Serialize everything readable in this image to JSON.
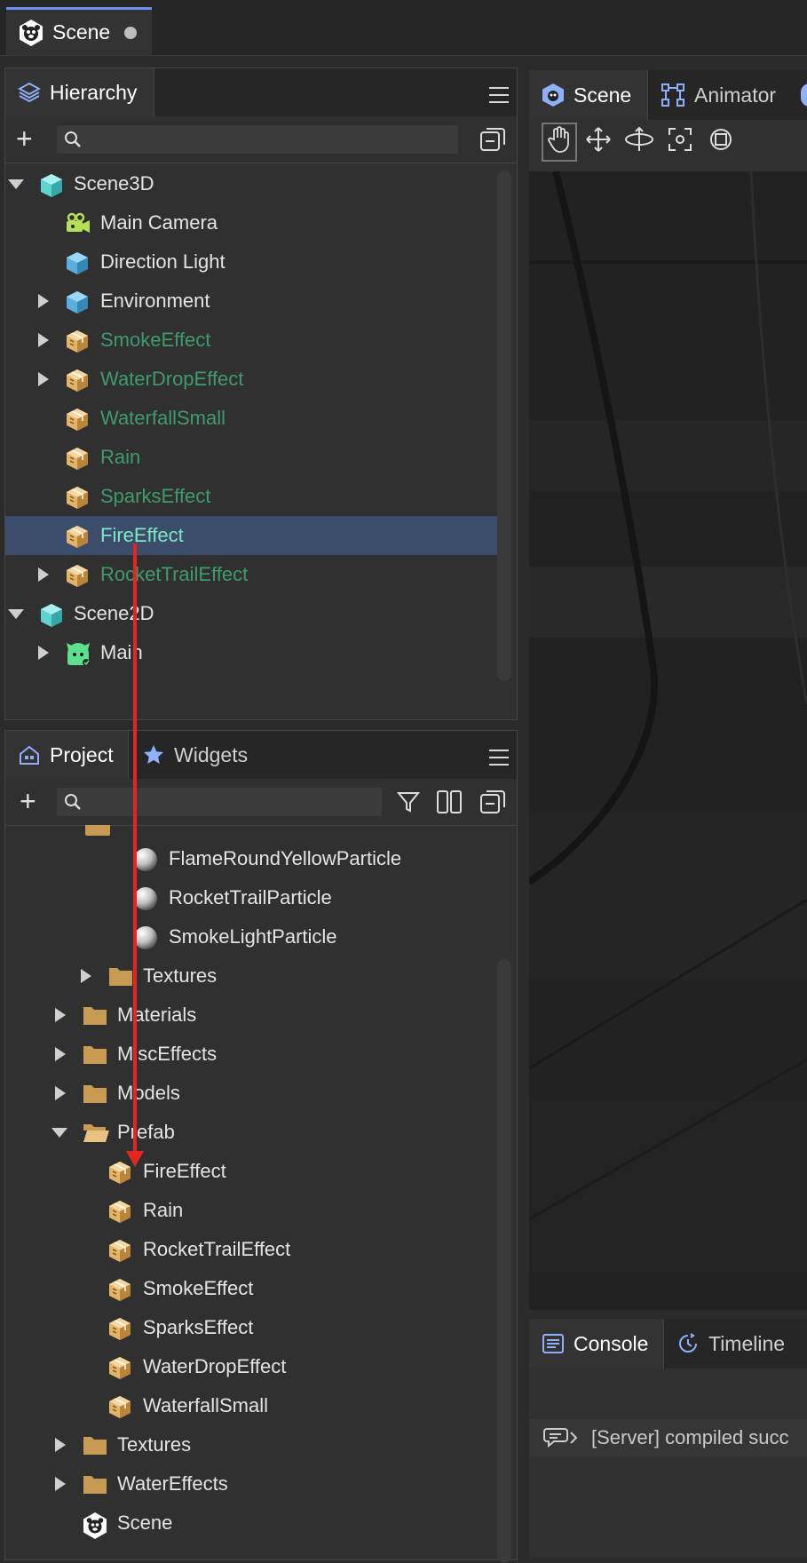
{
  "document_tab": {
    "label": "Scene"
  },
  "hierarchy": {
    "tab_label": "Hierarchy",
    "search_placeholder": "",
    "items": [
      {
        "label": "Scene3D",
        "kind": "scene3d",
        "level": 0,
        "arrow": "down",
        "prefab": false,
        "selected": false
      },
      {
        "label": "Main Camera",
        "kind": "camera",
        "level": 1,
        "arrow": "",
        "prefab": false,
        "selected": false
      },
      {
        "label": "Direction Light",
        "kind": "cube-blue",
        "level": 1,
        "arrow": "",
        "prefab": false,
        "selected": false
      },
      {
        "label": "Environment",
        "kind": "cube-blue",
        "level": 1,
        "arrow": "right",
        "prefab": false,
        "selected": false
      },
      {
        "label": "SmokeEffect",
        "kind": "prefab",
        "level": 1,
        "arrow": "right",
        "prefab": true,
        "selected": false
      },
      {
        "label": "WaterDropEffect",
        "kind": "prefab",
        "level": 1,
        "arrow": "right",
        "prefab": true,
        "selected": false
      },
      {
        "label": "WaterfallSmall",
        "kind": "prefab",
        "level": 1,
        "arrow": "",
        "prefab": true,
        "selected": false
      },
      {
        "label": "Rain",
        "kind": "prefab",
        "level": 1,
        "arrow": "",
        "prefab": true,
        "selected": false
      },
      {
        "label": "SparksEffect",
        "kind": "prefab",
        "level": 1,
        "arrow": "",
        "prefab": true,
        "selected": false
      },
      {
        "label": "FireEffect",
        "kind": "prefab",
        "level": 1,
        "arrow": "",
        "prefab": true,
        "selected": true
      },
      {
        "label": "RocketTrailEffect",
        "kind": "prefab",
        "level": 1,
        "arrow": "right",
        "prefab": true,
        "selected": false
      },
      {
        "label": "Scene2D",
        "kind": "scene3d",
        "level": 0,
        "arrow": "down",
        "prefab": false,
        "selected": false
      },
      {
        "label": "Main",
        "kind": "sprite",
        "level": 1,
        "arrow": "right",
        "prefab": false,
        "selected": false
      }
    ]
  },
  "project": {
    "tabs": [
      "Project",
      "Widgets"
    ],
    "search_placeholder": "",
    "items": [
      {
        "label": "FlameRoundYellowParticle",
        "kind": "material",
        "level": 3,
        "arrow": ""
      },
      {
        "label": "RocketTrailParticle",
        "kind": "material",
        "level": 3,
        "arrow": ""
      },
      {
        "label": "SmokeLightParticle",
        "kind": "material",
        "level": 3,
        "arrow": ""
      },
      {
        "label": "Textures",
        "kind": "folder",
        "level": 2,
        "arrow": "right"
      },
      {
        "label": "Materials",
        "kind": "folder",
        "level": 1,
        "arrow": "right"
      },
      {
        "label": "MiscEffects",
        "kind": "folder",
        "level": 1,
        "arrow": "right"
      },
      {
        "label": "Models",
        "kind": "folder",
        "level": 1,
        "arrow": "right"
      },
      {
        "label": "Prefab",
        "kind": "folder-open",
        "level": 1,
        "arrow": "down"
      },
      {
        "label": "FireEffect",
        "kind": "prefab",
        "level": 2,
        "arrow": ""
      },
      {
        "label": "Rain",
        "kind": "prefab",
        "level": 2,
        "arrow": ""
      },
      {
        "label": "RocketTrailEffect",
        "kind": "prefab",
        "level": 2,
        "arrow": ""
      },
      {
        "label": "SmokeEffect",
        "kind": "prefab",
        "level": 2,
        "arrow": ""
      },
      {
        "label": "SparksEffect",
        "kind": "prefab",
        "level": 2,
        "arrow": ""
      },
      {
        "label": "WaterDropEffect",
        "kind": "prefab",
        "level": 2,
        "arrow": ""
      },
      {
        "label": "WaterfallSmall",
        "kind": "prefab",
        "level": 2,
        "arrow": ""
      },
      {
        "label": "Textures",
        "kind": "folder",
        "level": 1,
        "arrow": "right"
      },
      {
        "label": "WaterEffects",
        "kind": "folder",
        "level": 1,
        "arrow": "right"
      },
      {
        "label": "Scene",
        "kind": "scene-file",
        "level": 1,
        "arrow": ""
      }
    ]
  },
  "scene_view": {
    "tabs": [
      "Scene",
      "Animator"
    ],
    "tools": [
      "hand-icon",
      "move-icon",
      "rotate-icon",
      "scale-icon",
      "rect-icon"
    ]
  },
  "console": {
    "tabs": [
      "Console",
      "Timeline"
    ],
    "message": "[Server] compiled succ"
  },
  "colors": {
    "accent": "#6c8ff0",
    "prefab_text": "#3f9b6d",
    "selected_row": "#3c4d6b",
    "drag_arrow": "#e52620"
  }
}
